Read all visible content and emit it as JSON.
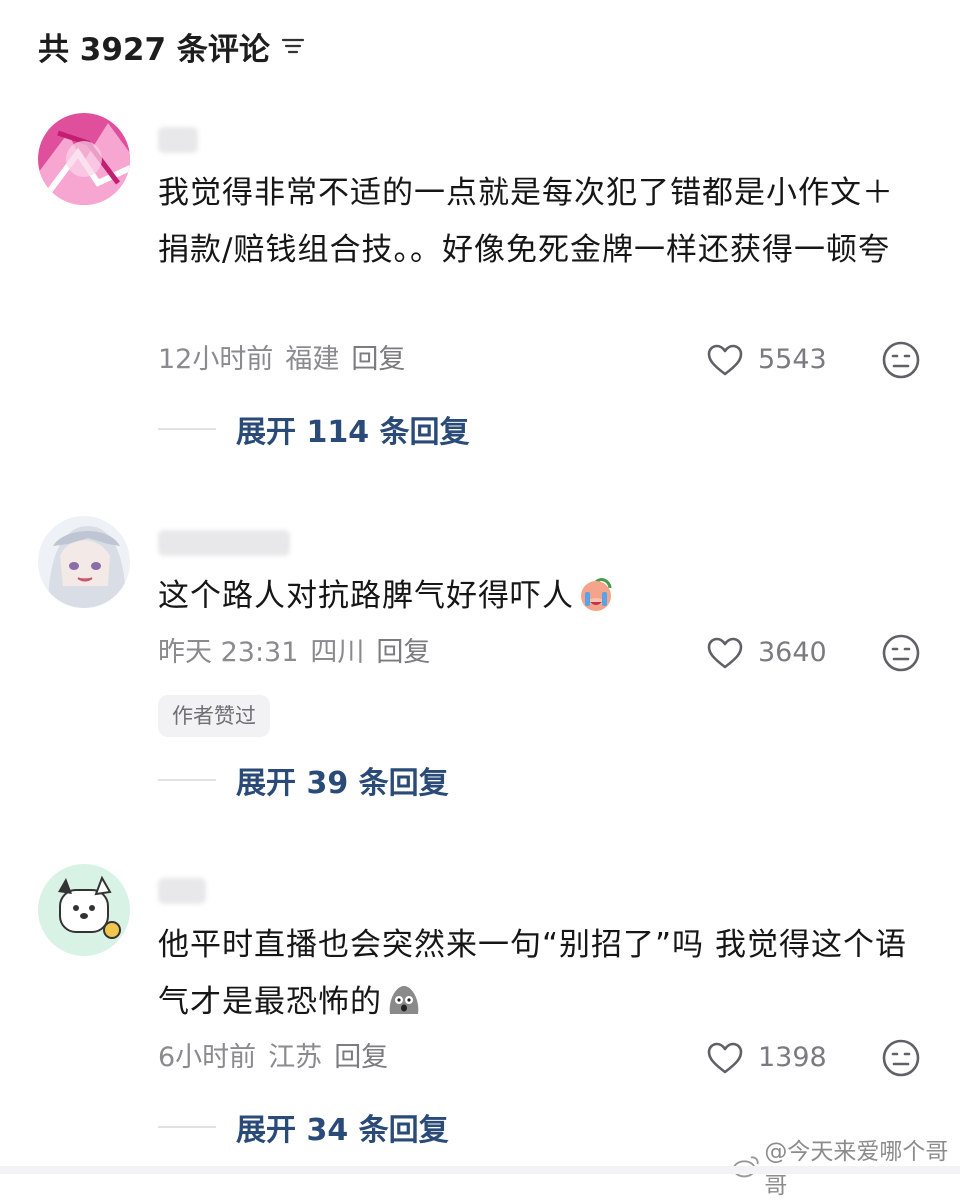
{
  "header": {
    "title": "共 3927 条评论",
    "filter_icon": "filter-lines-icon"
  },
  "comments": [
    {
      "avatar_icon": "pink-abstract-avatar",
      "username": "***",
      "content": "我觉得非常不适的一点就是每次犯了错都是小作文＋捐款/赔钱组合技。。好像免死金牌一样还获得一顿夸",
      "time": "12小时前",
      "location": "福建",
      "reply_label": "回复",
      "likes": "5543",
      "badge": "",
      "expand_label": "展开 114 条回复"
    },
    {
      "avatar_icon": "anime-girl-avatar",
      "username": "***",
      "content": "这个路人对抗路脾气好得吓人",
      "emoji": "crying-peach-emoji",
      "time": "昨天 23:31",
      "location": "四川",
      "reply_label": "回复",
      "likes": "3640",
      "badge": "作者赞过",
      "expand_label": "展开 39 条回复"
    },
    {
      "avatar_icon": "cartoon-dog-avatar",
      "username": "***",
      "content": "他平时直播也会突然来一句“别招了”吗 我觉得这个语气才是最恐怖的",
      "emoji": "shocked-blob-emoji",
      "time": "6小时前",
      "location": "江苏",
      "reply_label": "回复",
      "likes": "1398",
      "badge": "",
      "expand_label": "展开 34 条回复"
    }
  ],
  "watermark": "@今天来爱哪个哥哥"
}
